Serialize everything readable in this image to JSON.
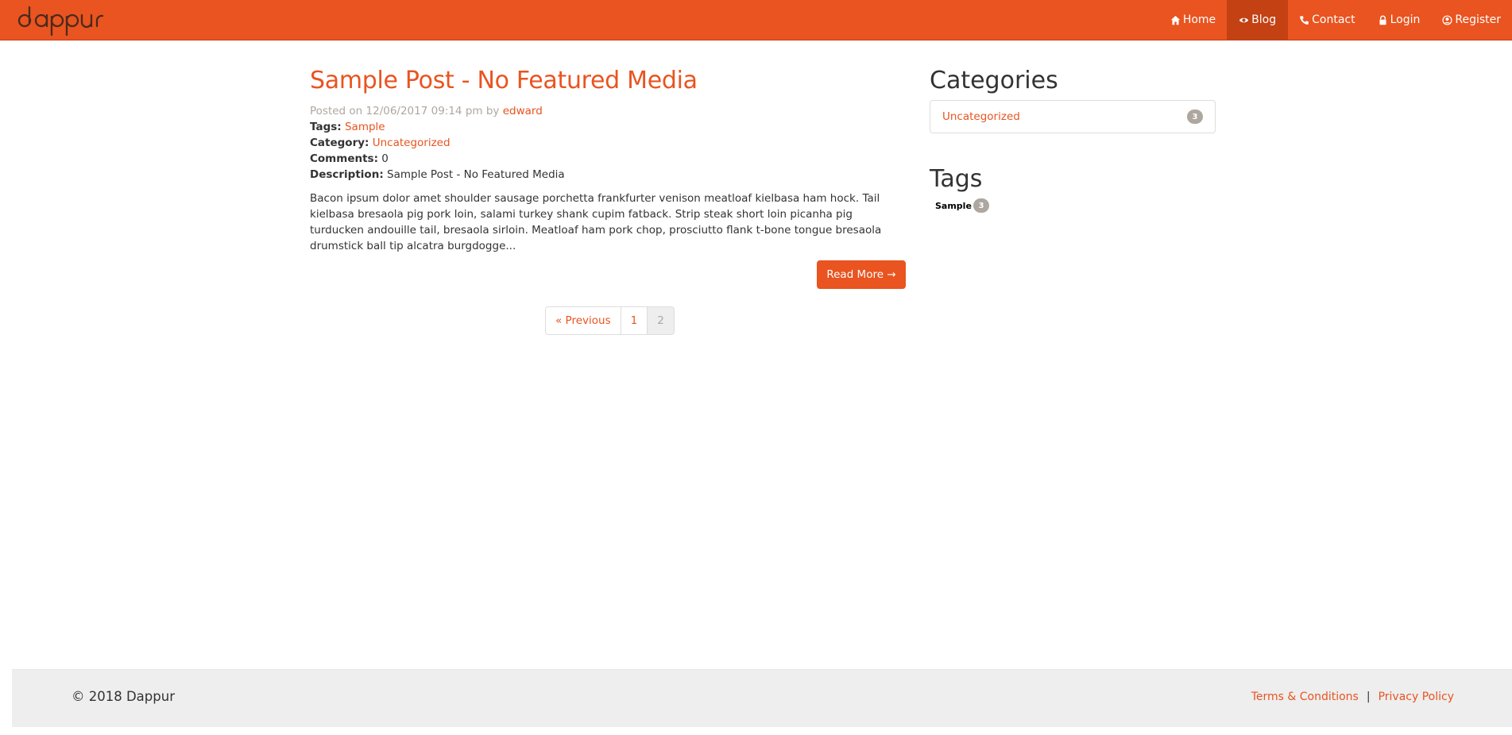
{
  "brand": {
    "logo_text": "dappur",
    "color": "#e95420"
  },
  "nav": {
    "items": [
      {
        "label": "Home",
        "icon": "home-icon"
      },
      {
        "label": "Blog",
        "icon": "eye-icon",
        "active": true
      },
      {
        "label": "Contact",
        "icon": "phone-icon"
      },
      {
        "label": "Login",
        "icon": "lock-icon"
      },
      {
        "label": "Register",
        "icon": "user-circle-icon"
      }
    ]
  },
  "post": {
    "title": "Sample Post - No Featured Media",
    "posted_prefix": "Posted on 12/06/2017 09:14 pm by",
    "author": "edward",
    "tags_label": "Tags:",
    "tags_value": "Sample",
    "category_label": "Category:",
    "category_value": "Uncategorized",
    "comments_label": "Comments:",
    "comments_value": "0",
    "description_label": "Description:",
    "description_value": "Sample Post - No Featured Media",
    "excerpt": "Bacon ipsum dolor amet shoulder sausage porchetta frankfurter venison meatloaf kielbasa ham hock. Tail kielbasa bresaola pig pork loin, salami turkey shank cupim fatback. Strip steak short loin picanha pig turducken andouille tail, bresaola sirloin. Meatloaf ham pork chop, prosciutto flank t-bone tongue bresaola drumstick ball tip alcatra burgdogge...",
    "read_more": "Read More →"
  },
  "pagination": {
    "previous": "« Previous",
    "pages": [
      "1",
      "2"
    ],
    "current": "2"
  },
  "sidebar": {
    "categories_heading": "Categories",
    "categories": [
      {
        "label": "Uncategorized",
        "count": "3"
      }
    ],
    "tags_heading": "Tags",
    "tags": [
      {
        "label": "Sample",
        "count": "3"
      }
    ]
  },
  "footer": {
    "copyright": "© 2018 Dappur",
    "terms": "Terms & Conditions",
    "separator": "|",
    "privacy": "Privacy Policy"
  }
}
